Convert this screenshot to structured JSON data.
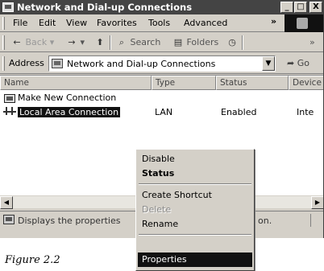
{
  "window": {
    "title": "Network and Dial-up Connections",
    "controls": {
      "minimize": "_",
      "maximize": "□",
      "close": "X"
    }
  },
  "menubar": {
    "items": [
      "File",
      "Edit",
      "View",
      "Favorites",
      "Tools",
      "Advanced"
    ],
    "overflow": "»"
  },
  "toolbar": {
    "back": "Back",
    "forward": "→",
    "search": "Search",
    "folders": "Folders",
    "overflow": "»"
  },
  "address": {
    "label": "Address",
    "value": "Network and Dial-up Connections",
    "go": "Go"
  },
  "list": {
    "columns": [
      "Name",
      "Type",
      "Status",
      "Device"
    ],
    "rows": [
      {
        "name": "Make New Connection",
        "type": "",
        "status": "",
        "device": ""
      },
      {
        "name": "Local Area Connection",
        "type": "LAN",
        "status": "Enabled",
        "device": "Inte"
      }
    ]
  },
  "statusbar": {
    "text": "Displays the properties",
    "tail": "on."
  },
  "context_menu": {
    "items": [
      {
        "label": "Disable",
        "style": "normal"
      },
      {
        "label": "Status",
        "style": "bold"
      },
      {
        "label": "Create Shortcut",
        "style": "normal"
      },
      {
        "label": "Delete",
        "style": "disabled"
      },
      {
        "label": "Rename",
        "style": "normal"
      },
      {
        "label": "Properties",
        "style": "highlight"
      }
    ]
  },
  "caption": "Figure 2.2"
}
